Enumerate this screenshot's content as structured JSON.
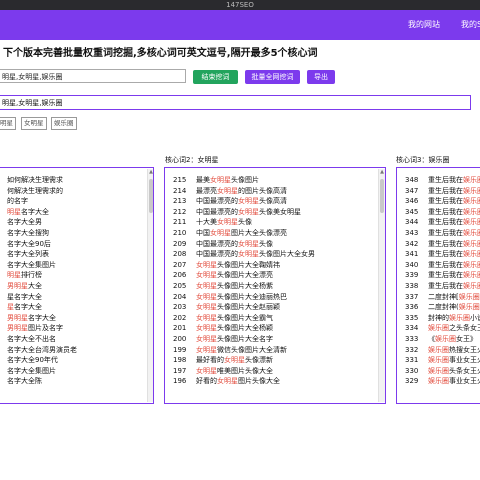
{
  "window": {
    "title": "147SEO"
  },
  "nav": {
    "my_site": "我的网站",
    "my_site_cut": "我的S"
  },
  "headline": "下个版本完善批量权重词挖掘,多核心词可英文逗号,隔开最多5个核心词",
  "keyword_input": {
    "value": "明星,女明星,娱乐圈"
  },
  "buttons": {
    "end_mining": "结束挖词",
    "batch_mining": "批量全网挖词",
    "export": "导出"
  },
  "tag_input": {
    "value": "明星,女明星,娱乐圈"
  },
  "chips": [
    "明星",
    "女明星",
    "娱乐圈"
  ],
  "columns": [
    {
      "title": "",
      "rows": [
        {
          "num": "",
          "segs": [
            {
              "t": "如何解决生理需求"
            }
          ]
        },
        {
          "num": "",
          "segs": [
            {
              "t": "何解决生理需求的"
            }
          ]
        },
        {
          "num": "",
          "segs": [
            {
              "t": "的名字"
            }
          ]
        },
        {
          "num": "",
          "segs": [
            {
              "t": "明星",
              "h": true
            },
            {
              "t": "名字大全"
            }
          ]
        },
        {
          "num": "",
          "segs": [
            {
              "t": "名字大全男"
            }
          ]
        },
        {
          "num": "",
          "segs": [
            {
              "t": "名字大全搜狗"
            }
          ]
        },
        {
          "num": "",
          "segs": [
            {
              "t": "名字大全90后"
            }
          ]
        },
        {
          "num": "",
          "segs": [
            {
              "t": "名字大全列表"
            }
          ]
        },
        {
          "num": "",
          "segs": [
            {
              "t": "名字大全集图片"
            }
          ]
        },
        {
          "num": "",
          "segs": [
            {
              "t": "明星",
              "h": true
            },
            {
              "t": "排行榜"
            }
          ]
        },
        {
          "num": "",
          "segs": [
            {
              "t": "男明星",
              "h": true
            },
            {
              "t": "大全"
            }
          ]
        },
        {
          "num": "",
          "segs": [
            {
              "t": "星名字大全"
            }
          ]
        },
        {
          "num": "",
          "segs": [
            {
              "t": "星",
              "h": true
            },
            {
              "t": "名字大全"
            }
          ]
        },
        {
          "num": "",
          "segs": [
            {
              "t": "男明星",
              "h": true
            },
            {
              "t": "名字大全"
            }
          ]
        },
        {
          "num": "",
          "segs": [
            {
              "t": "男明星",
              "h": true
            },
            {
              "t": "图片及名字"
            }
          ]
        },
        {
          "num": "",
          "segs": [
            {
              "t": "名字大全不出名"
            }
          ]
        },
        {
          "num": "",
          "segs": [
            {
              "t": "名字大全台湾男演员老"
            }
          ]
        },
        {
          "num": "",
          "segs": [
            {
              "t": "名字大全90年代"
            }
          ]
        },
        {
          "num": "",
          "segs": [
            {
              "t": "名字大全集图片"
            }
          ]
        },
        {
          "num": "",
          "segs": [
            {
              "t": "名字大全陈"
            }
          ]
        }
      ]
    },
    {
      "title": "核心词2：女明星",
      "rows": [
        {
          "num": "215",
          "segs": [
            {
              "t": "最美"
            },
            {
              "t": "女明星",
              "h": true
            },
            {
              "t": "头像图片"
            }
          ]
        },
        {
          "num": "214",
          "segs": [
            {
              "t": "最漂亮"
            },
            {
              "t": "女明星",
              "h": true
            },
            {
              "t": "的图片头像高清"
            }
          ]
        },
        {
          "num": "213",
          "segs": [
            {
              "t": "中国最漂亮的"
            },
            {
              "t": "女明星",
              "h": true
            },
            {
              "t": "头像高清"
            }
          ]
        },
        {
          "num": "212",
          "segs": [
            {
              "t": "中国最漂亮的"
            },
            {
              "t": "女明星",
              "h": true
            },
            {
              "t": "头像美女明星"
            }
          ]
        },
        {
          "num": "211",
          "segs": [
            {
              "t": "十大美"
            },
            {
              "t": "女明星",
              "h": true
            },
            {
              "t": "头像"
            }
          ]
        },
        {
          "num": "210",
          "segs": [
            {
              "t": "中国"
            },
            {
              "t": "女明星",
              "h": true
            },
            {
              "t": "图片大全头像漂亮"
            }
          ]
        },
        {
          "num": "209",
          "segs": [
            {
              "t": "中国最漂亮的"
            },
            {
              "t": "女明星",
              "h": true
            },
            {
              "t": "头像"
            }
          ]
        },
        {
          "num": "208",
          "segs": [
            {
              "t": "中国最漂亮的"
            },
            {
              "t": "女明星",
              "h": true
            },
            {
              "t": "头像图片大全女男"
            }
          ]
        },
        {
          "num": "207",
          "segs": [
            {
              "t": "女明星",
              "h": true
            },
            {
              "t": "头像图片大全鞠婧祎"
            }
          ]
        },
        {
          "num": "206",
          "segs": [
            {
              "t": "女明星",
              "h": true
            },
            {
              "t": "头像图片大全漂亮"
            }
          ]
        },
        {
          "num": "205",
          "segs": [
            {
              "t": "女明星",
              "h": true
            },
            {
              "t": "头像图片大全杨紫"
            }
          ]
        },
        {
          "num": "204",
          "segs": [
            {
              "t": "女明星",
              "h": true
            },
            {
              "t": "头像图片大全迪丽热巴"
            }
          ]
        },
        {
          "num": "203",
          "segs": [
            {
              "t": "女明星",
              "h": true
            },
            {
              "t": "头像图片大全赵丽颖"
            }
          ]
        },
        {
          "num": "202",
          "segs": [
            {
              "t": "女明星",
              "h": true
            },
            {
              "t": "头像图片大全霸气"
            }
          ]
        },
        {
          "num": "201",
          "segs": [
            {
              "t": "女明星",
              "h": true
            },
            {
              "t": "头像图片大全杨颖"
            }
          ]
        },
        {
          "num": "200",
          "segs": [
            {
              "t": "女明星",
              "h": true
            },
            {
              "t": "头像图片大全名字"
            }
          ]
        },
        {
          "num": "199",
          "segs": [
            {
              "t": "女明星",
              "h": true
            },
            {
              "t": "微信头像图片大全清新"
            }
          ]
        },
        {
          "num": "198",
          "segs": [
            {
              "t": "最好看的"
            },
            {
              "t": "女明星",
              "h": true
            },
            {
              "t": "头像漂新"
            }
          ]
        },
        {
          "num": "197",
          "segs": [
            {
              "t": "女明星",
              "h": true
            },
            {
              "t": "唯美图片头像大全"
            }
          ]
        },
        {
          "num": "196",
          "segs": [
            {
              "t": "好看的"
            },
            {
              "t": "女明星",
              "h": true
            },
            {
              "t": "图片头像大全"
            }
          ]
        }
      ]
    },
    {
      "title": "核心词3：娱乐圈",
      "rows": [
        {
          "num": "348",
          "segs": [
            {
              "t": "重生后我在"
            },
            {
              "t": "娱乐圈",
              "h": true
            }
          ]
        },
        {
          "num": "347",
          "segs": [
            {
              "t": "重生后我在"
            },
            {
              "t": "娱乐圈",
              "h": true
            }
          ]
        },
        {
          "num": "346",
          "segs": [
            {
              "t": "重生后我在"
            },
            {
              "t": "娱乐圈",
              "h": true
            }
          ]
        },
        {
          "num": "345",
          "segs": [
            {
              "t": "重生后我在"
            },
            {
              "t": "娱乐圈",
              "h": true
            }
          ]
        },
        {
          "num": "344",
          "segs": [
            {
              "t": "重生后我在"
            },
            {
              "t": "娱乐圈",
              "h": true
            }
          ]
        },
        {
          "num": "343",
          "segs": [
            {
              "t": "重生后我在"
            },
            {
              "t": "娱乐圈",
              "h": true
            }
          ]
        },
        {
          "num": "342",
          "segs": [
            {
              "t": "重生后我在"
            },
            {
              "t": "娱乐圈",
              "h": true
            }
          ]
        },
        {
          "num": "341",
          "segs": [
            {
              "t": "重生后我在"
            },
            {
              "t": "娱乐圈",
              "h": true
            }
          ]
        },
        {
          "num": "340",
          "segs": [
            {
              "t": "重生后我在"
            },
            {
              "t": "娱乐圈",
              "h": true
            }
          ]
        },
        {
          "num": "339",
          "segs": [
            {
              "t": "重生后我在"
            },
            {
              "t": "娱乐圈",
              "h": true
            }
          ]
        },
        {
          "num": "338",
          "segs": [
            {
              "t": "重生后我在"
            },
            {
              "t": "娱乐圈",
              "h": true
            }
          ]
        },
        {
          "num": "337",
          "segs": [
            {
              "t": "二度封神["
            },
            {
              "t": "娱乐圈",
              "h": true
            }
          ]
        },
        {
          "num": "336",
          "segs": [
            {
              "t": "二度封神("
            },
            {
              "t": "娱乐圈",
              "h": true
            }
          ]
        },
        {
          "num": "335",
          "segs": [
            {
              "t": "封神的"
            },
            {
              "t": "娱乐圈",
              "h": true
            },
            {
              "t": "小说"
            }
          ]
        },
        {
          "num": "334",
          "segs": [
            {
              "t": "娱乐圈",
              "h": true
            },
            {
              "t": "之头条女王"
            }
          ]
        },
        {
          "num": "333",
          "segs": [
            {
              "t": "《"
            },
            {
              "t": "娱乐圈",
              "h": true
            },
            {
              "t": "女王》"
            }
          ]
        },
        {
          "num": "332",
          "segs": [
            {
              "t": "娱乐圈",
              "h": true
            },
            {
              "t": "热搜女王火"
            }
          ]
        },
        {
          "num": "331",
          "segs": [
            {
              "t": "娱乐圈",
              "h": true
            },
            {
              "t": "事业女王火"
            }
          ]
        },
        {
          "num": "330",
          "segs": [
            {
              "t": "娱乐圈",
              "h": true
            },
            {
              "t": "头条女王火"
            }
          ]
        },
        {
          "num": "329",
          "segs": [
            {
              "t": "娱乐圈",
              "h": true
            },
            {
              "t": "事业女王火"
            }
          ]
        }
      ]
    }
  ]
}
